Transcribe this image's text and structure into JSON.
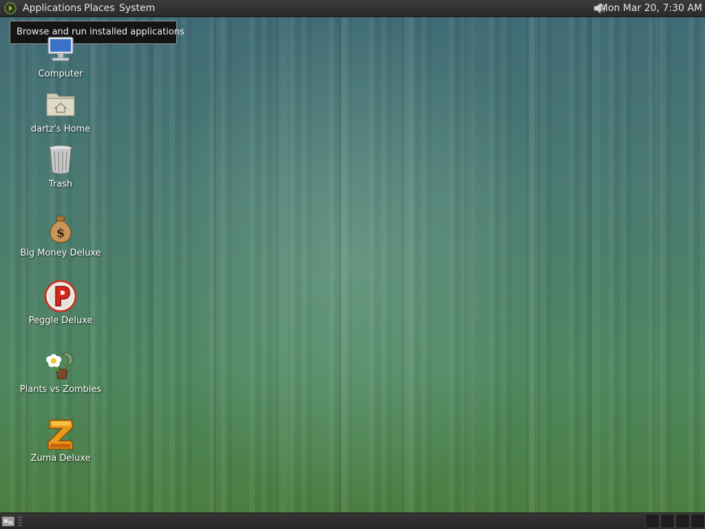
{
  "top_panel": {
    "menus": [
      "Applications",
      "Places",
      "System"
    ],
    "clock": "Mon Mar 20,  7:30 AM",
    "volume_icon": "speaker-icon",
    "apps_icon": "gnome-foot-icon"
  },
  "tooltip": {
    "text": "Browse and run installed applications"
  },
  "desktop_icons": [
    {
      "label": "Computer",
      "icon": "computer-icon"
    },
    {
      "label": "dartz's Home",
      "icon": "home-folder-icon"
    },
    {
      "label": "Trash",
      "icon": "trash-icon"
    },
    {
      "label": "Big Money Deluxe",
      "icon": "money-bag-icon"
    },
    {
      "label": "Peggle Deluxe",
      "icon": "peggle-icon"
    },
    {
      "label": "Plants vs Zombies",
      "icon": "plants-zombies-icon"
    },
    {
      "label": "Zuma Deluxe",
      "icon": "zuma-icon"
    }
  ],
  "bottom_panel": {
    "show_desktop_icon": "show-desktop-icon",
    "workspaces": 4
  },
  "colors": {
    "panel": "#2f2f2f",
    "wallpaper_top": "#3f6a76",
    "wallpaper_bottom": "#4a7d3c"
  }
}
